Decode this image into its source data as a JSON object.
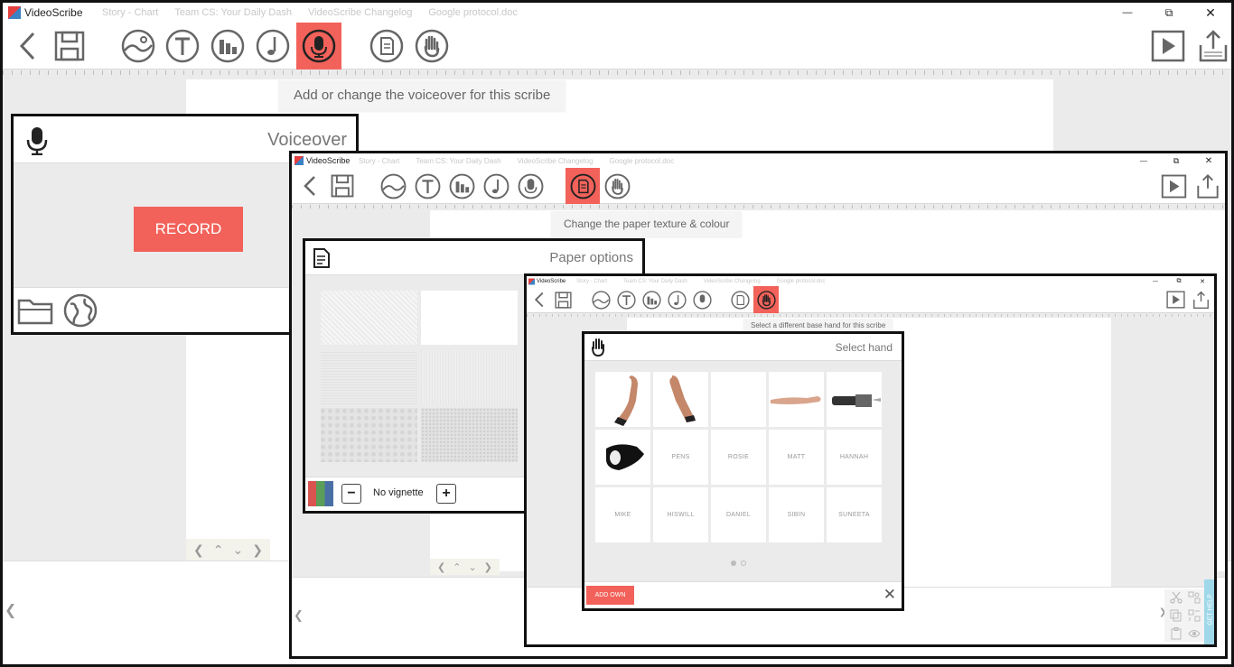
{
  "app": {
    "title": "VideoScribe",
    "ghost_tabs": [
      "Story - Chart",
      "Team CS: Your Daily Dash",
      "VideoScribe Changelog",
      "Google protocol.doc"
    ]
  },
  "window_controls": {
    "minimize": "—",
    "maximize": "⧉",
    "close": "✕"
  },
  "toolbar": {
    "items": [
      {
        "name": "back-button",
        "icon": "chevron-left-icon"
      },
      {
        "name": "save-button",
        "icon": "floppy-disk-icon"
      },
      {
        "name": "image-button",
        "icon": "image-icon"
      },
      {
        "name": "text-button",
        "icon": "text-t-icon"
      },
      {
        "name": "chart-button",
        "icon": "bar-chart-icon"
      },
      {
        "name": "music-button",
        "icon": "music-note-icon"
      },
      {
        "name": "voiceover-button",
        "icon": "microphone-icon"
      },
      {
        "name": "paper-button",
        "icon": "paper-icon"
      },
      {
        "name": "hand-button",
        "icon": "hand-icon"
      }
    ],
    "right": [
      {
        "name": "play-button",
        "icon": "play-icon"
      },
      {
        "name": "export-button",
        "icon": "export-icon"
      }
    ],
    "accent_color": "#f2625a"
  },
  "screen1": {
    "tooltip": "Add or change the voiceover for this scribe",
    "panel": {
      "title": "Voiceover",
      "record_label": "RECORD"
    }
  },
  "screen2": {
    "tooltip": "Change the paper texture & colour",
    "panel": {
      "title": "Paper options",
      "vignette_label": "No vignette",
      "minus": "−",
      "plus": "+"
    }
  },
  "screen3": {
    "tooltip": "Select a different base hand for this scribe",
    "panel": {
      "title": "Select hand",
      "hands": [
        "",
        "",
        "",
        "",
        "",
        "",
        "PENS",
        "ROSIE",
        "MATT",
        "HANNAH",
        "MIKE",
        "HISWILL",
        "DANIEL",
        "SIBIN",
        "SUNEETA"
      ],
      "add_own_label": "ADD OWN",
      "close": "✕"
    },
    "get_help_label": "GET HELP"
  }
}
